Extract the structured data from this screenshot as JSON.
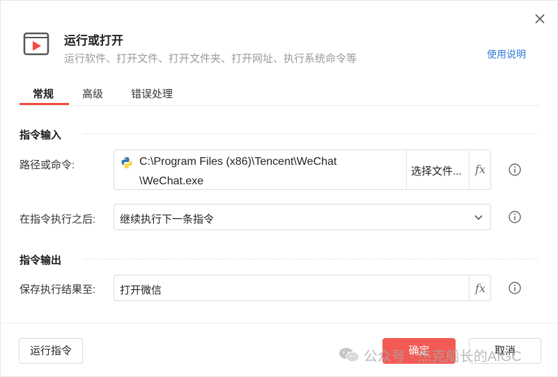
{
  "dialog": {
    "title": "运行或打开",
    "subtitle": "运行软件、打开文件、打开文件夹、打开网址、执行系统命令等",
    "help_link": "使用说明",
    "icons": {
      "header": "video-play-icon",
      "close": "close-icon"
    }
  },
  "tabs": [
    {
      "label": "常规",
      "active": true
    },
    {
      "label": "高级",
      "active": false
    },
    {
      "label": "错误处理",
      "active": false
    }
  ],
  "sections": {
    "input": {
      "title": "指令输入",
      "path_label": "路径或命令:",
      "path_value_line1": "C:\\Program Files (x86)\\Tencent\\WeChat",
      "path_value_line2": "\\WeChat.exe",
      "choose_file_label": "选择文件...",
      "fx_label": "fx",
      "after_label": "在指令执行之后:",
      "after_value": "继续执行下一条指令"
    },
    "output": {
      "title": "指令输出",
      "save_label": "保存执行结果至:",
      "save_value": "打开微信",
      "fx_label": "fx"
    }
  },
  "footer": {
    "run_label": "运行指令",
    "ok_label": "确定",
    "cancel_label": "取消"
  },
  "watermark": {
    "text": "公众号 · 杰克船长的AIGC"
  },
  "colors": {
    "accent": "#f35a54",
    "tab_underline": "#f04a43",
    "link": "#2a7bd8",
    "python_blue": "#3776ab",
    "python_yellow": "#ffd43b"
  }
}
